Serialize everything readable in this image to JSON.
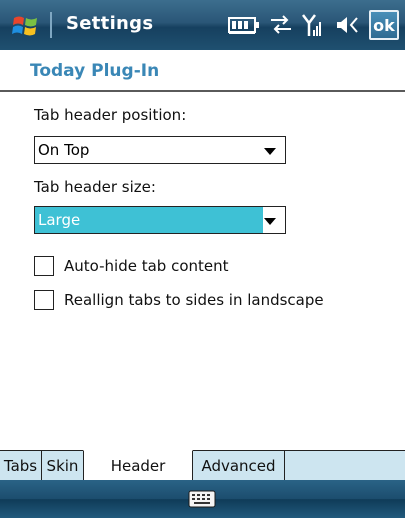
{
  "titlebar": {
    "app_title": "Settings",
    "ok_label": "ok",
    "icons": [
      "windows-start-icon",
      "battery-icon",
      "connectivity-icon",
      "signal-icon",
      "volume-icon"
    ]
  },
  "page": {
    "title": "Today Plug-In"
  },
  "form": {
    "position_label": "Tab header position:",
    "position_value": "On Top",
    "size_label": "Tab header size:",
    "size_value": "Large",
    "autohide_label": "Auto-hide tab content",
    "autohide_checked": false,
    "realign_label": "Reallign tabs to sides in landscape",
    "realign_checked": false
  },
  "tabs": [
    {
      "label": "Tabs",
      "active": false
    },
    {
      "label": "Skin",
      "active": false
    },
    {
      "label": "Header",
      "active": true
    },
    {
      "label": "Advanced",
      "active": false
    }
  ],
  "bottombar": {
    "icon": "keyboard-icon"
  },
  "colors": {
    "accent": "#3a87b6",
    "selection": "#3ec1d5",
    "tab_bg": "#cde5f0"
  }
}
